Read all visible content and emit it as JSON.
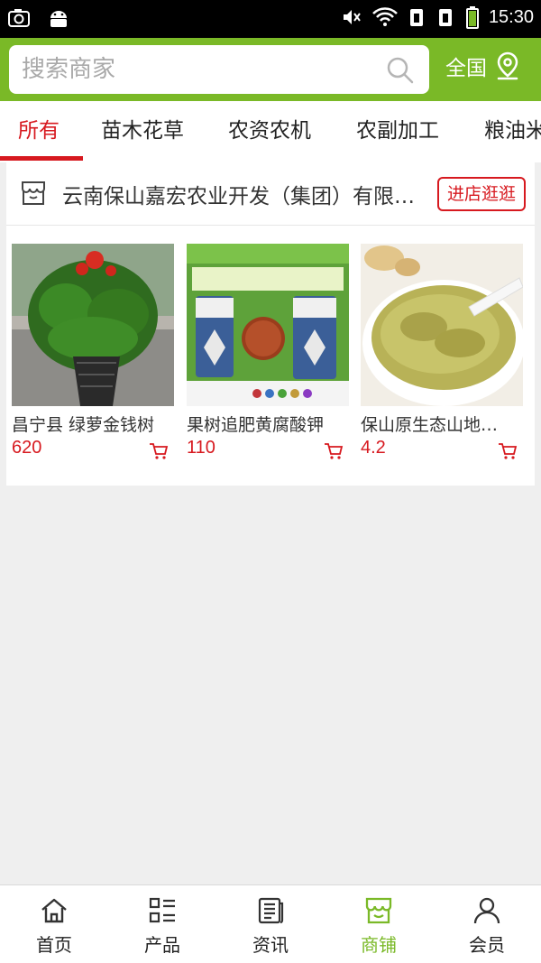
{
  "status_bar": {
    "time": "15:30"
  },
  "search": {
    "placeholder": "搜索商家"
  },
  "header": {
    "region_label": "全国"
  },
  "tabs": [
    {
      "label": "所有",
      "active": true
    },
    {
      "label": "苗木花草"
    },
    {
      "label": "农资农机"
    },
    {
      "label": "农副加工"
    },
    {
      "label": "粮油米"
    }
  ],
  "shop": {
    "name": "云南保山嘉宏农业开发（集团）有限公司",
    "visit_label": "进店逛逛",
    "products": [
      {
        "name": "昌宁县 绿萝金钱树",
        "price": "620",
        "image": "potted-green-plant"
      },
      {
        "name": "果树追肥黄腐酸钾",
        "price": "110",
        "image": "fertilizer-bags"
      },
      {
        "name": "保山原生态山地绿豆",
        "price": "4.2",
        "image": "mung-bean-soup"
      }
    ]
  },
  "bottom_nav": [
    {
      "label": "首页",
      "icon": "home-icon"
    },
    {
      "label": "产品",
      "icon": "list-icon"
    },
    {
      "label": "资讯",
      "icon": "news-icon"
    },
    {
      "label": "商铺",
      "icon": "store-icon",
      "active": true
    },
    {
      "label": "会员",
      "icon": "user-icon"
    }
  ],
  "colors": {
    "brand_green": "#7ab927",
    "accent_red": "#d7191f"
  }
}
